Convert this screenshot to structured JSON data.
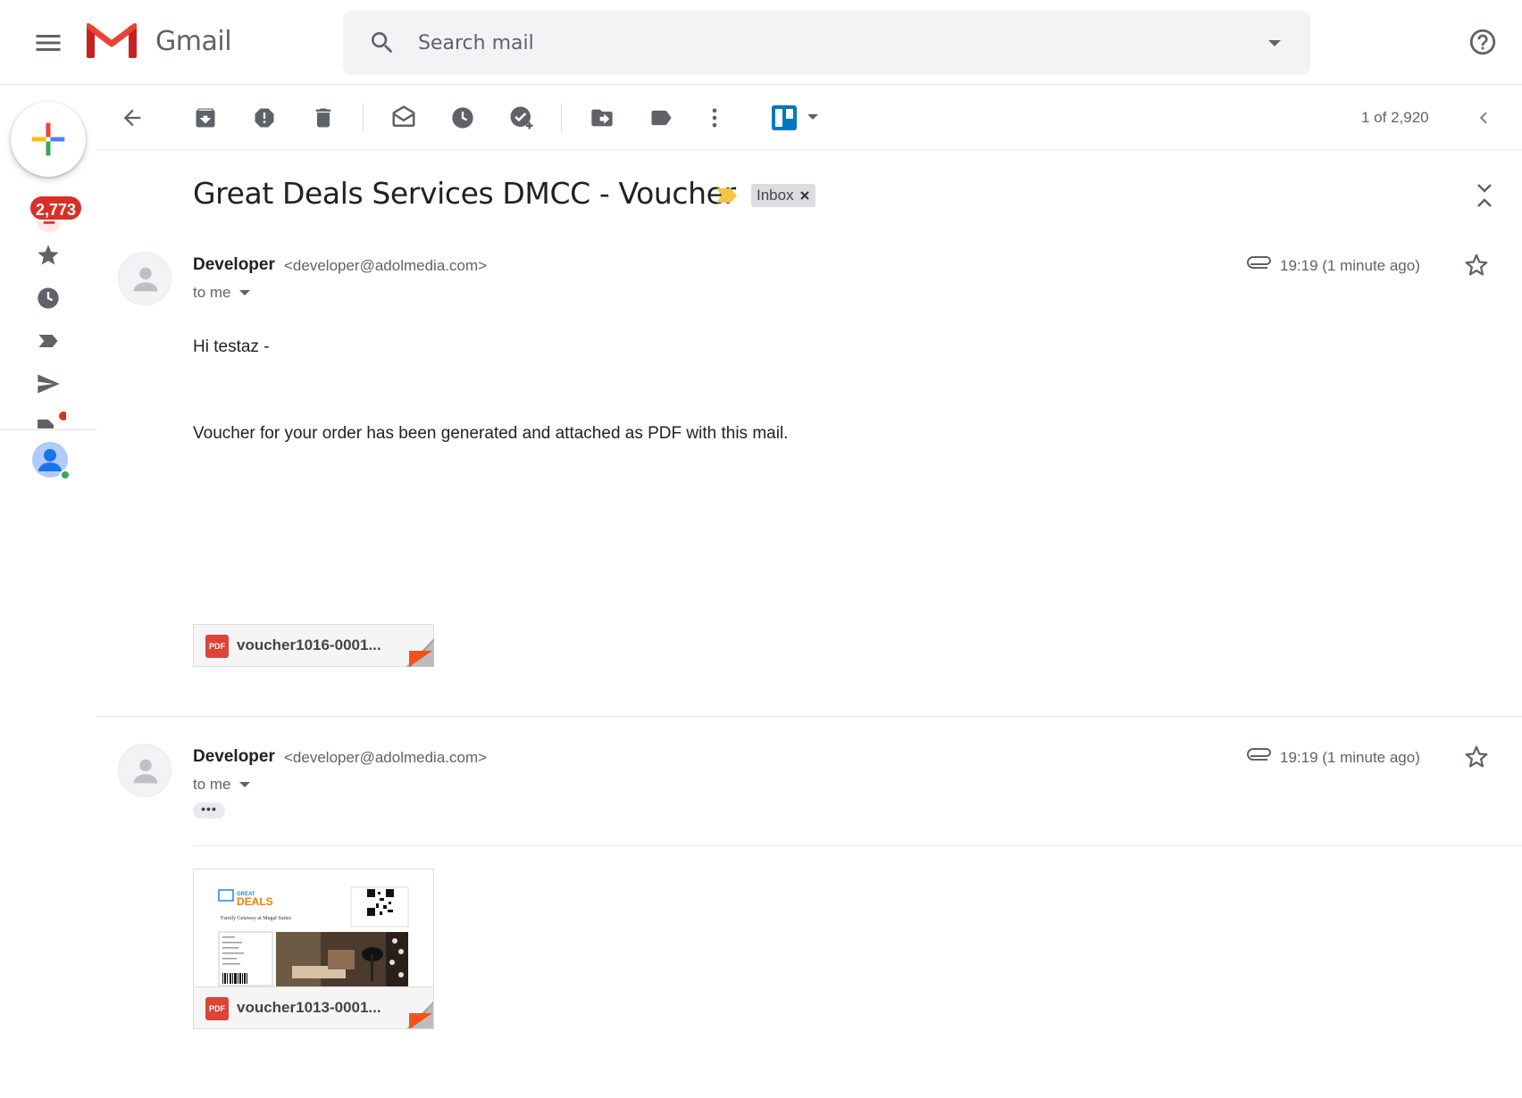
{
  "app": {
    "product_name": "Gmail"
  },
  "search": {
    "placeholder": "Search mail"
  },
  "rail": {
    "unread_count": "2,773"
  },
  "toolbar": {
    "pager": "1 of 2,920"
  },
  "thread": {
    "subject": "Great Deals Services DMCC - Voucher",
    "label": "Inbox"
  },
  "messages": [
    {
      "sender_name": "Developer",
      "sender_email": "<developer@adolmedia.com>",
      "recipient": "to me",
      "time": "19:19 (1 minute ago)",
      "body": [
        "Hi testaz -",
        "Voucher for your order has been generated and attached as PDF with this mail."
      ],
      "attachment": {
        "type": "PDF",
        "name": "voucher1016-0001..."
      }
    },
    {
      "sender_name": "Developer",
      "sender_email": "<developer@adolmedia.com>",
      "recipient": "to me",
      "time": "19:19 (1 minute ago)",
      "trimmed": "•••",
      "attachment": {
        "type": "PDF",
        "name": "voucher1013-0001...",
        "preview": {
          "brand_top": "GREAT",
          "brand_bottom": "DEALS",
          "title": "Family Getaway at Mugal Suites"
        }
      }
    }
  ],
  "colors": {
    "accent_red": "#d93025",
    "importance": "#f4c542",
    "pdf_red": "#db4437",
    "fold_red": "#f4511e"
  },
  "icons": [
    "menu-icon",
    "gmail-logo",
    "search-icon",
    "search-options-icon",
    "help-icon",
    "compose-icon",
    "inbox-icon",
    "star-icon",
    "clock-icon",
    "label-icon",
    "send-icon",
    "draft-icon",
    "avatar-icon",
    "back-icon",
    "archive-icon",
    "report-spam-icon",
    "delete-icon",
    "mark-unread-icon",
    "snooze-icon",
    "add-task-icon",
    "move-to-icon",
    "labels-icon",
    "more-icon",
    "trello-icon",
    "chevron-left-icon",
    "importance-icon",
    "close-icon",
    "expand-collapse-icon",
    "paperclip-icon",
    "person-icon",
    "caret-down-icon"
  ]
}
